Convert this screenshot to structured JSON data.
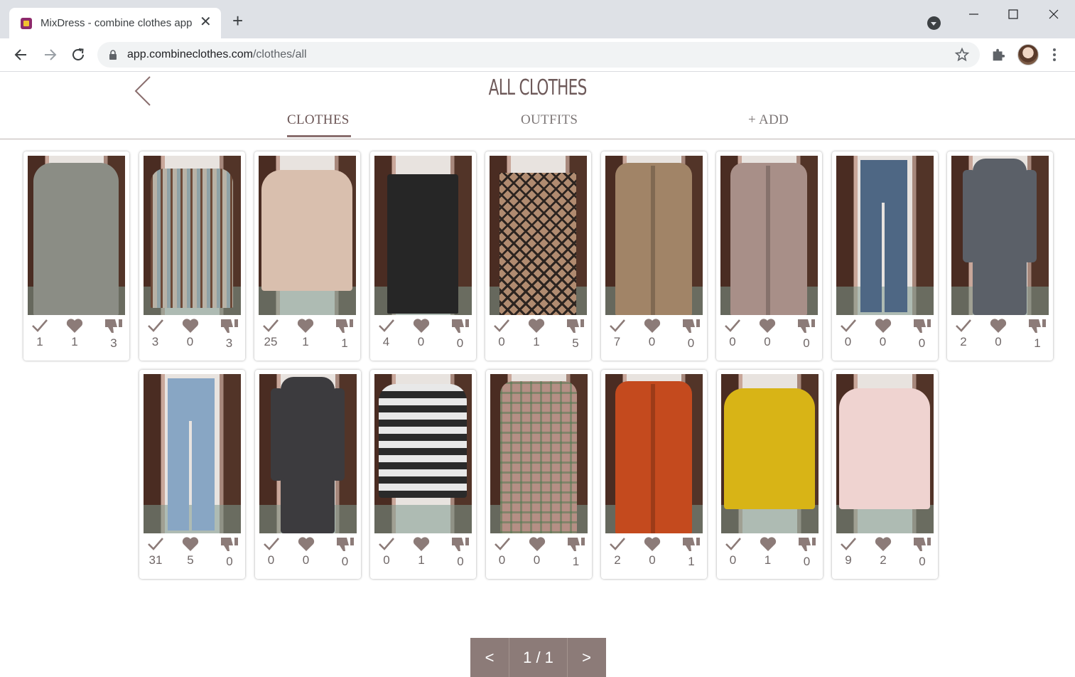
{
  "browser": {
    "tab_title": "MixDress - combine clothes app",
    "url_host": "app.combineclothes.com",
    "url_path": "/clothes/all"
  },
  "page": {
    "title": "ALL CLOTHES",
    "tabs": [
      {
        "label": "CLOTHES",
        "active": true
      },
      {
        "label": "OUTFITS",
        "active": false
      },
      {
        "label": "+ ADD",
        "active": false
      }
    ]
  },
  "items": [
    {
      "worn": "1",
      "likes": "1",
      "dislikes": "3",
      "color": "#8b8d85",
      "shape": "tunic"
    },
    {
      "worn": "3",
      "likes": "0",
      "dislikes": "3",
      "color": "#8a8478",
      "shape": "striped"
    },
    {
      "worn": "25",
      "likes": "1",
      "dislikes": "1",
      "color": "#d9bfae",
      "shape": "sweater"
    },
    {
      "worn": "4",
      "likes": "0",
      "dislikes": "0",
      "color": "#262626",
      "shape": "skirt"
    },
    {
      "worn": "0",
      "likes": "1",
      "dislikes": "5",
      "color": "#b08b70",
      "shape": "patternskirt"
    },
    {
      "worn": "7",
      "likes": "0",
      "dislikes": "0",
      "color": "#a18467",
      "shape": "cardigan"
    },
    {
      "worn": "0",
      "likes": "0",
      "dislikes": "0",
      "color": "#a88f88",
      "shape": "cardigan"
    },
    {
      "worn": "0",
      "likes": "0",
      "dislikes": "0",
      "color": "#4e6784",
      "shape": "jeans"
    },
    {
      "worn": "2",
      "likes": "0",
      "dislikes": "1",
      "color": "#5b6068",
      "shape": "dress"
    },
    {
      "worn": "31",
      "likes": "5",
      "dislikes": "0",
      "color": "#88a6c4",
      "shape": "jeans"
    },
    {
      "worn": "0",
      "likes": "0",
      "dislikes": "0",
      "color": "#3c3b3e",
      "shape": "dress"
    },
    {
      "worn": "0",
      "likes": "1",
      "dislikes": "0",
      "color": "#3a3a3a",
      "shape": "stripesweater"
    },
    {
      "worn": "0",
      "likes": "0",
      "dislikes": "1",
      "color": "#b58f85",
      "shape": "coat"
    },
    {
      "worn": "2",
      "likes": "0",
      "dislikes": "1",
      "color": "#c44a1e",
      "shape": "cardigan"
    },
    {
      "worn": "0",
      "likes": "1",
      "dislikes": "0",
      "color": "#d8b416",
      "shape": "sweater"
    },
    {
      "worn": "9",
      "likes": "2",
      "dislikes": "0",
      "color": "#efd3d0",
      "shape": "sweater"
    }
  ],
  "icons": {
    "worn": "check-icon",
    "likes": "heart-icon",
    "dislikes": "thumbs-down-icon"
  },
  "pager": {
    "prev": "<",
    "page": "1 / 1",
    "next": ">"
  },
  "colors": {
    "accent": "#8c7b78",
    "title": "#6e5a5a",
    "icon": "#8c7b78"
  }
}
